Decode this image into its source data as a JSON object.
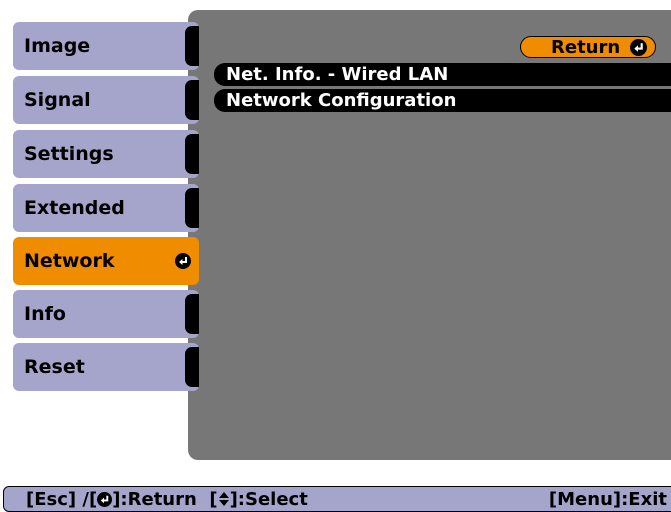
{
  "sidebar": {
    "items": [
      {
        "label": "Image"
      },
      {
        "label": "Signal"
      },
      {
        "label": "Settings"
      },
      {
        "label": "Extended"
      },
      {
        "label": "Network",
        "active": true
      },
      {
        "label": "Info"
      },
      {
        "label": "Reset"
      }
    ]
  },
  "panel": {
    "return_label": "Return",
    "items": [
      {
        "label": "Net. Info. - Wired LAN"
      },
      {
        "label": "Network Configuration"
      }
    ]
  },
  "status_bar": {
    "esc_prefix": "[Esc] /[",
    "return_suffix": "]:Return  [",
    "select_suffix": "]:Select",
    "menu_exit": "[Menu]:Exit"
  },
  "colors": {
    "active": "#f08c00",
    "sidebar": "#a5a5cc",
    "panel": "#777777"
  }
}
